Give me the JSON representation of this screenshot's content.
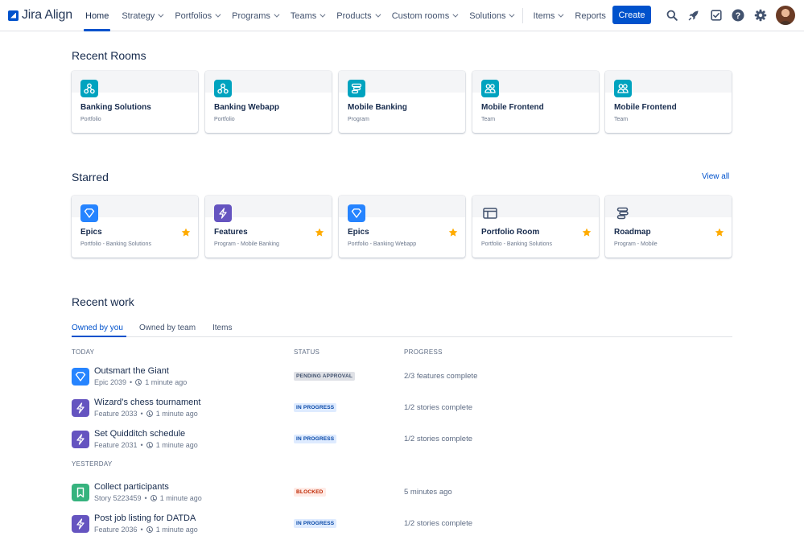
{
  "app": {
    "logo_text": "Jira Align"
  },
  "nav": {
    "items": [
      {
        "label": "Home",
        "active": true,
        "dropdown": false
      },
      {
        "label": "Strategy",
        "dropdown": true
      },
      {
        "label": "Portfolios",
        "dropdown": true
      },
      {
        "label": "Programs",
        "dropdown": true
      },
      {
        "label": "Teams",
        "dropdown": true
      },
      {
        "label": "Products",
        "dropdown": true
      },
      {
        "label": "Custom rooms",
        "dropdown": true
      },
      {
        "label": "Solutions",
        "dropdown": true
      },
      {
        "label": "Items",
        "dropdown": true
      },
      {
        "label": "Reports",
        "dropdown": false
      }
    ],
    "create_label": "Create",
    "icons": [
      "search-icon",
      "rocket-icon",
      "checkbox-icon",
      "help-icon",
      "gear-icon"
    ]
  },
  "recent_rooms": {
    "title": "Recent Rooms",
    "cards": [
      {
        "name": "Banking Solutions",
        "type": "Portfolio",
        "icon": "portfolio-icon",
        "color": "#00a3bf"
      },
      {
        "name": "Banking Webapp",
        "type": "Portfolio",
        "icon": "portfolio-icon",
        "color": "#00a3bf"
      },
      {
        "name": "Mobile Banking",
        "type": "Program",
        "icon": "program-icon",
        "color": "#00a3bf"
      },
      {
        "name": "Mobile Frontend",
        "type": "Team",
        "icon": "team-icon",
        "color": "#00a3bf"
      },
      {
        "name": "Mobile Frontend",
        "type": "Team",
        "icon": "team-icon",
        "color": "#00a3bf"
      }
    ]
  },
  "starred": {
    "title": "Starred",
    "view_all": "View all",
    "cards": [
      {
        "name": "Epics",
        "context": "Portfolio - Banking Solutions",
        "icon": "epic-icon",
        "color": "#2684ff"
      },
      {
        "name": "Features",
        "context": "Program - Mobile Banking",
        "icon": "feature-icon",
        "color": "#6554c0"
      },
      {
        "name": "Epics",
        "context": "Portfolio - Banking Webapp",
        "icon": "epic-icon",
        "color": "#2684ff"
      },
      {
        "name": "Portfolio Room",
        "context": "Portfolio - Banking Solutions",
        "icon": "room-icon",
        "color": "#42526e"
      },
      {
        "name": "Roadmap",
        "context": "Program - Mobile",
        "icon": "roadmap-icon",
        "color": "#42526e"
      }
    ]
  },
  "recent_work": {
    "title": "Recent work",
    "tabs": [
      "Owned by you",
      "Owned by team",
      "Items"
    ],
    "columns": {
      "status": "STATUS",
      "progress": "PROGRESS"
    },
    "groups": [
      {
        "label": "TODAY",
        "rows": [
          {
            "title": "Outsmart the Giant",
            "ref": "Epic 2039",
            "time": "1 minute ago",
            "status": "PENDING APPROVAL",
            "status_kind": "pending",
            "progress": "2/3 features complete",
            "icon": "epic-icon"
          },
          {
            "title": "Wizard’s chess tournament",
            "ref": "Feature 2033",
            "time": "1 minute ago",
            "status": "IN PROGRESS",
            "status_kind": "progress",
            "progress": "1/2 stories complete",
            "icon": "feature-icon"
          },
          {
            "title": "Set Quidditch schedule",
            "ref": "Feature 2031",
            "time": "1 minute ago",
            "status": "IN PROGRESS",
            "status_kind": "progress",
            "progress": "1/2 stories complete",
            "icon": "feature-icon"
          }
        ]
      },
      {
        "label": "YESTERDAY",
        "rows": [
          {
            "title": "Collect participants",
            "ref": "Story 5223459",
            "time": "1 minute ago",
            "status": "BLOCKED",
            "status_kind": "blocked",
            "progress": "5 minutes ago",
            "icon": "story-icon"
          },
          {
            "title": "Post job listing for DATDA",
            "ref": "Feature 2036",
            "time": "1 minute ago",
            "status": "IN PROGRESS",
            "status_kind": "progress",
            "progress": "1/2 stories complete",
            "icon": "feature-icon"
          }
        ]
      }
    ]
  }
}
